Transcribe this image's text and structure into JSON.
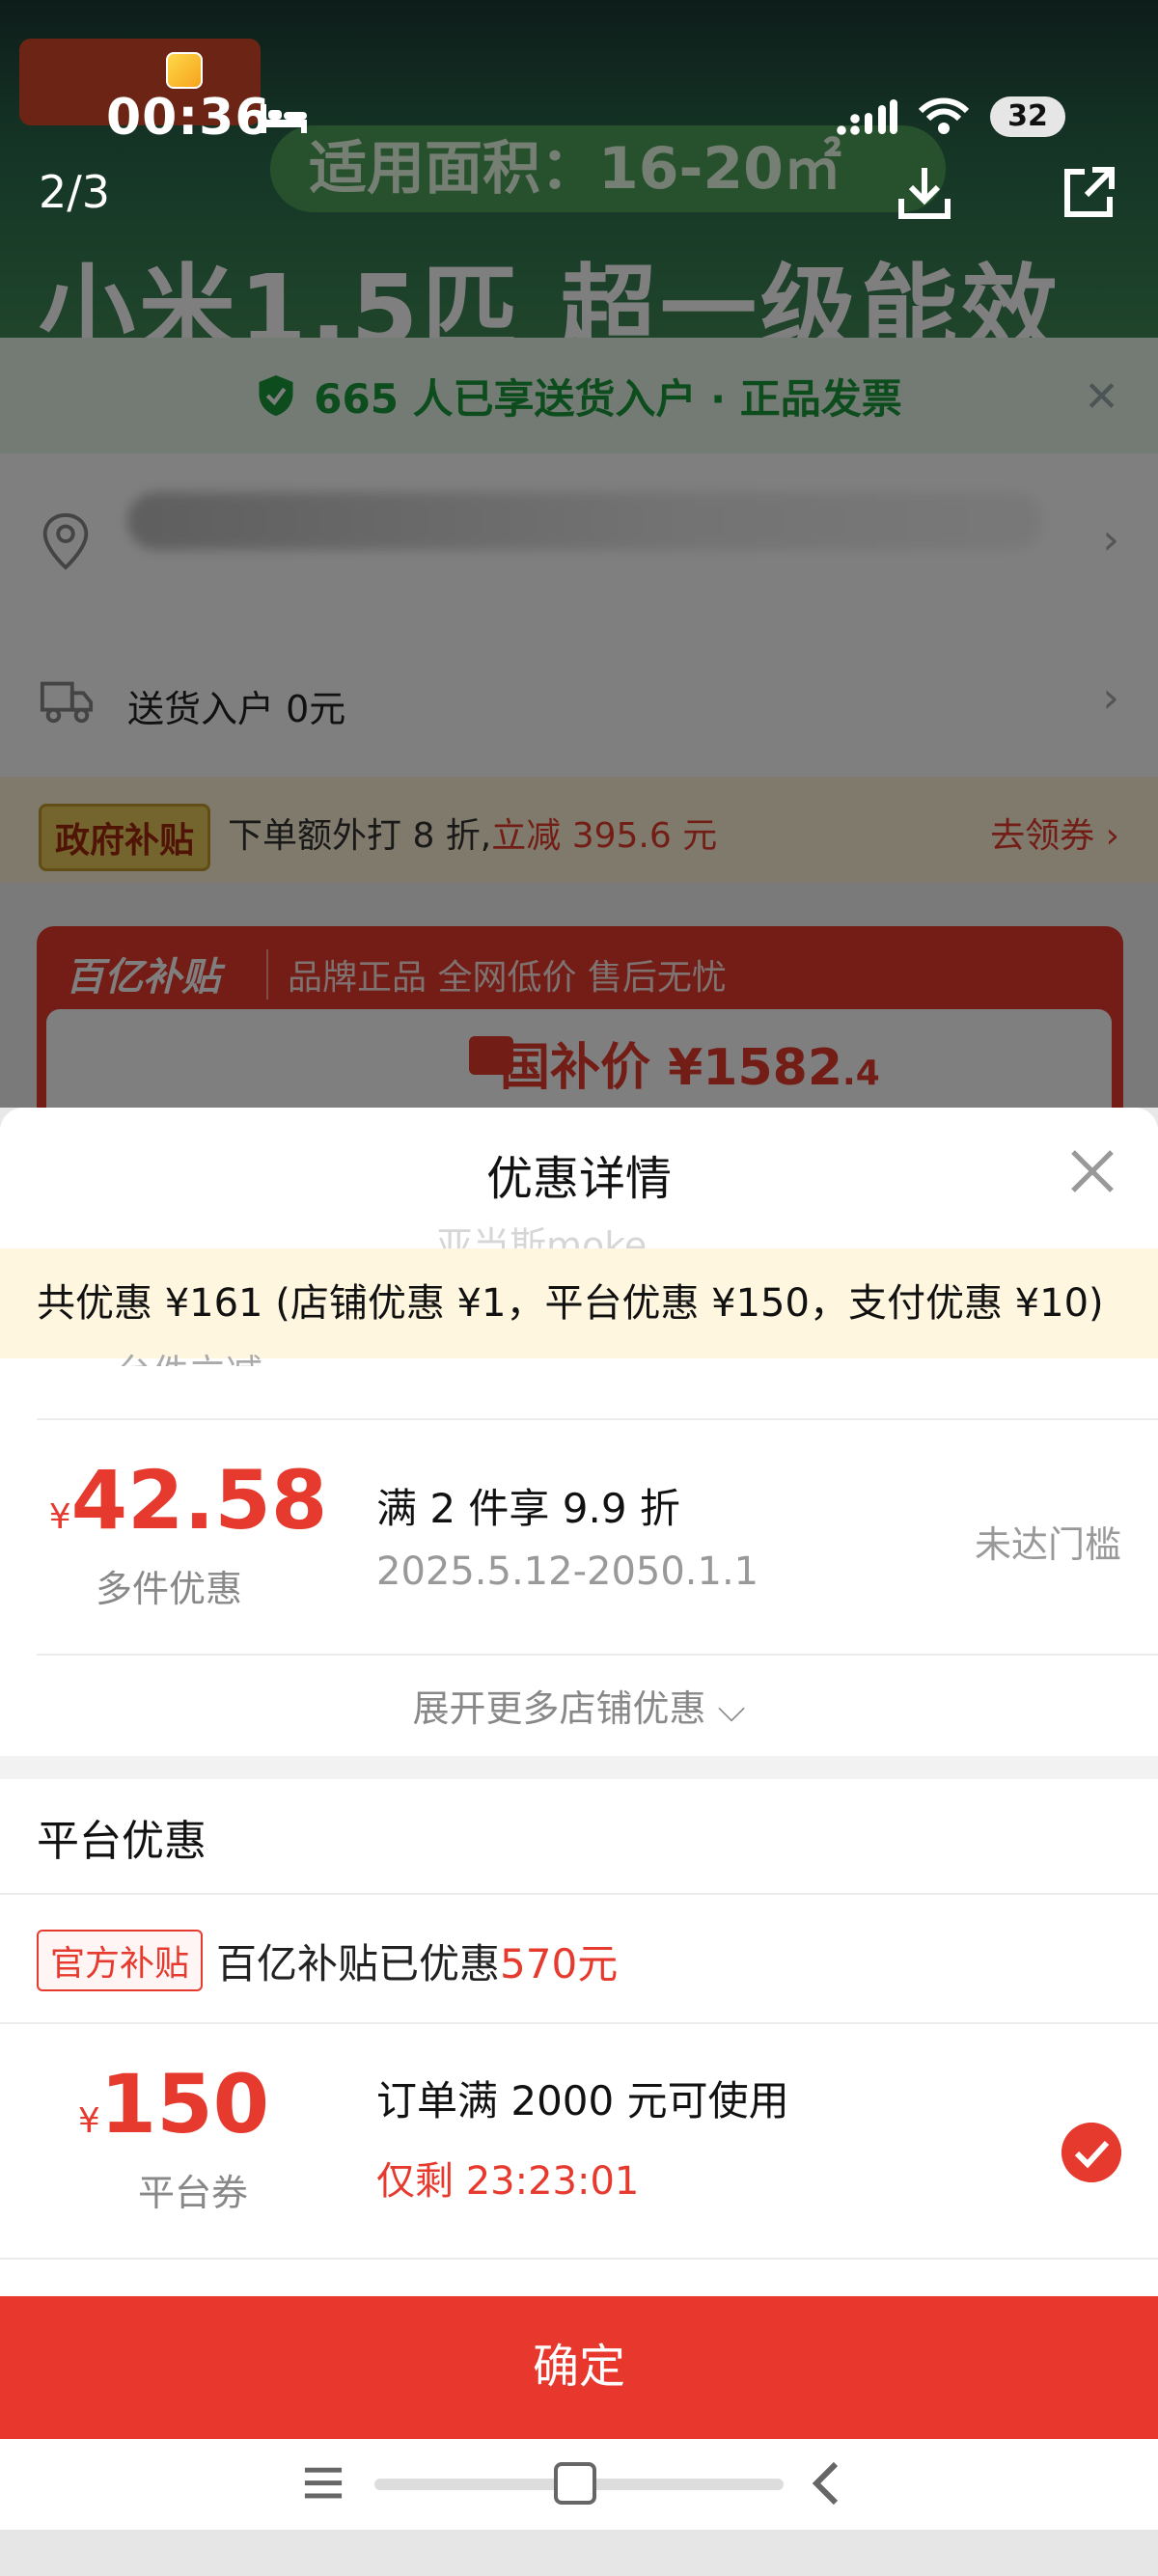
{
  "status_bar": {
    "time": "00:36",
    "battery": "32"
  },
  "gallery": {
    "page_indicator": "2/3"
  },
  "background_page": {
    "hero_area_text": "适用面积：16-20㎡",
    "hero_title": "小米1.5匹 超一级能效",
    "delivery_banner": "665 人已享送货入户 · 正品发票",
    "delivery_row": "送货入户 0元",
    "gov_subsidy": {
      "badge": "政府补贴",
      "text": "下单额外打 8 折,",
      "highlight": "立减 395.6 元",
      "link": "去领券 ›"
    },
    "subsidy_card": {
      "title": "百亿补贴",
      "slogan": "品牌正品 全网低价 售后无忧",
      "price_label": "国补价 ¥1582",
      "price_decimal": ".4"
    }
  },
  "sheet": {
    "title": "优惠详情",
    "watermark": "亚当斯moke",
    "summary": "共优惠 ¥161 (店铺优惠 ¥1，平台优惠 ¥150，支付优惠 ¥10)",
    "clipped_text": "台件立减",
    "store_coupon": {
      "currency": "¥",
      "amount": "42.58",
      "type": "多件优惠",
      "title": "满 2 件享 9.9 折",
      "date": "2025.5.12-2050.1.1",
      "status": "未达门槛"
    },
    "expand_more": "展开更多店铺优惠 ⌵",
    "platform_section_title": "平台优惠",
    "official": {
      "badge": "官方补贴",
      "text": "百亿补贴已优惠",
      "amount": "570元"
    },
    "platform_coupon": {
      "currency": "¥",
      "amount": "150",
      "type": "平台券",
      "title": "订单满 2000 元可使用",
      "countdown": "仅剩 23:23:01",
      "selected": true
    },
    "confirm_label": "确定"
  },
  "colors": {
    "accent_red": "#e63a2e",
    "summary_bg": "#fff6e0",
    "green": "#1b9a3a"
  },
  "icons": [
    "notification-icon",
    "bed-icon",
    "signal-icon",
    "wifi-icon",
    "download-icon",
    "share-icon",
    "shield-icon",
    "location-icon",
    "truck-icon",
    "close-icon",
    "check-icon",
    "menu-icon",
    "home-icon",
    "back-icon"
  ]
}
